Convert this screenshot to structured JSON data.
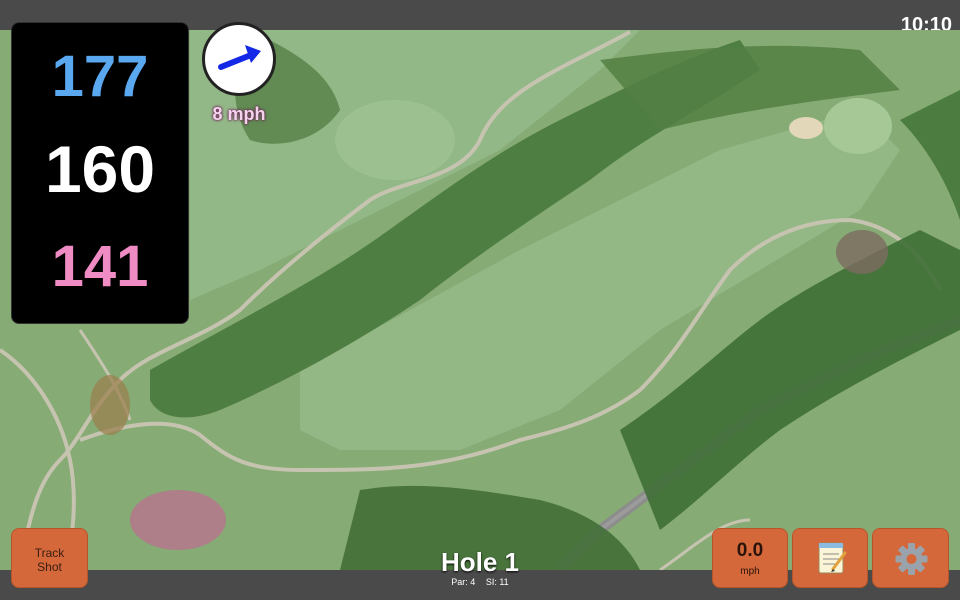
{
  "status": {
    "time": "10:10"
  },
  "yardages": {
    "back": "177",
    "middle": "160",
    "front": "141"
  },
  "wind": {
    "speed_label": "8 mph",
    "icon": "wind-arrow-icon"
  },
  "hole": {
    "title": "Hole 1",
    "par_label": "Par: 4",
    "si_label": "SI: 11"
  },
  "buttons": {
    "track_line1": "Track",
    "track_line2": "Shot",
    "speed_value": "0.0",
    "speed_unit": "mph",
    "notes_icon": "notepad-icon",
    "settings_icon": "gear-icon"
  },
  "colors": {
    "back_yardage": "#5aa8f0",
    "middle_yardage": "#ffffff",
    "front_yardage": "#f08cc4",
    "button": "#d4683a"
  }
}
